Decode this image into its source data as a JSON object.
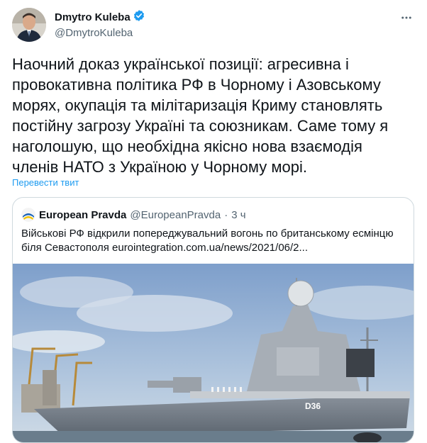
{
  "tweet": {
    "author": {
      "name": "Dmytro Kuleba",
      "handle": "@DmytroKuleba"
    },
    "text": "Наочний доказ української позиції: агресивна і\nпровокативна політика РФ в Чорному і Азовському\nморях, окупація та мілітаризація Криму становлять\nпостійну загрозу Україні та союзникам. Саме тому я\nнаголошую, що необхідна якісно нова взаємодія\nчленів НАТО з Україною у Чорному морі.",
    "translate_link": "Перевести твит",
    "more_icon": "more-horizontal-icon"
  },
  "quoted": {
    "name": "European Pravda",
    "handle": "@EuropeanPravda",
    "separator": "·",
    "time": "3 ч",
    "text": "Військові РФ відкрили попереджувальний вогонь по британському есмінцю\nбіля Севастополя eurointegration.com.ua/news/2021/06/2...",
    "ship_hull_number": "D36"
  },
  "colors": {
    "link": "#1d9bf0",
    "verified": "#1d9bf0",
    "secondary_text": "#536471",
    "border": "#cfd9de"
  }
}
